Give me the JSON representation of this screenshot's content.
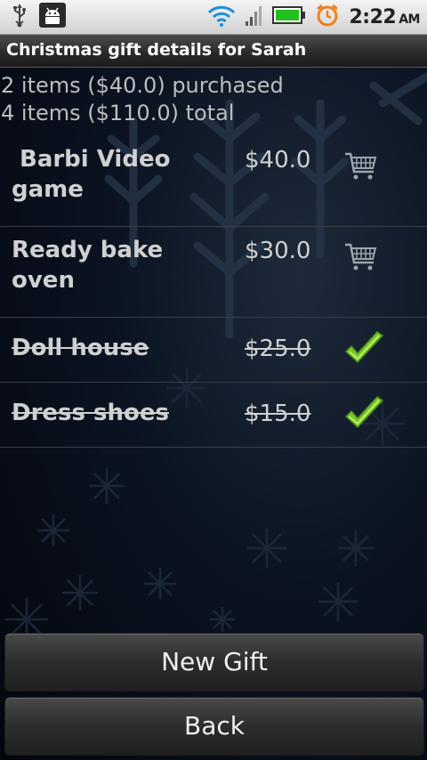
{
  "status_bar": {
    "left_icons": [
      "usb-icon",
      "android-debug-icon"
    ],
    "right_icons": [
      "wifi-icon",
      "signal-icon",
      "battery-icon",
      "alarm-icon"
    ],
    "time": "2:22",
    "ampm": "AM",
    "battery_color": "#22c01e"
  },
  "title": "Christmas gift details for Sarah",
  "summary": {
    "purchased": "2 items ($40.0) purchased",
    "total": "4 items ($110.0) total"
  },
  "gifts": [
    {
      "name": "Barbi Video game",
      "price": "$40.0",
      "purchased": false,
      "icon": "cart-icon"
    },
    {
      "name": "Ready bake oven",
      "price": "$30.0",
      "purchased": false,
      "icon": "cart-icon"
    },
    {
      "name": "Doll house",
      "price": "$25.0",
      "purchased": true,
      "icon": "checkmark-icon"
    },
    {
      "name": "Dress shoes",
      "price": "$15.0",
      "purchased": true,
      "icon": "checkmark-icon"
    }
  ],
  "buttons": {
    "new_gift": "New Gift",
    "back": "Back"
  },
  "colors": {
    "check_green": "#7ac72a",
    "text": "#d0d0d0"
  }
}
